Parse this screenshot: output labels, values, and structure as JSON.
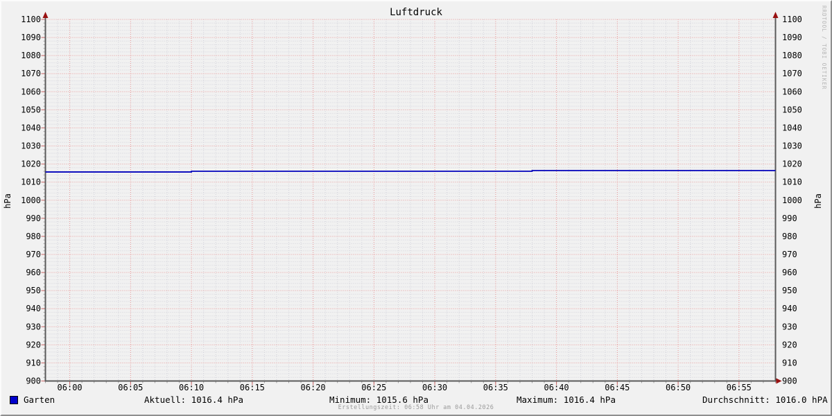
{
  "title": "Luftdruck",
  "watermark": "RRDTOOL / TOBI OETIKER",
  "axes": {
    "unit_left": "hPa",
    "unit_right": "hPa"
  },
  "legend": {
    "series_label": "Garten",
    "series_color": "#0000cc",
    "current": "Aktuell: 1016.4 hPa",
    "minimum": "Minimum: 1015.6 hPa",
    "maximum": "Maximum: 1016.4 hPa",
    "average": "Durchschnitt: 1016.0 hPA"
  },
  "footer": {
    "creation_note": "Erstellungszeit: 06:58 Uhr am 04.04.2026"
  },
  "chart_data": {
    "type": "line",
    "title": "Luftdruck",
    "xlabel": "",
    "ylabel": "hPa",
    "ylim": [
      900,
      1100
    ],
    "y_major_step": 10,
    "y_minor_step": 2,
    "x_start": "05:58",
    "x_end": "06:58",
    "x_minor_step_minutes": 1,
    "x_ticks": [
      "06:00",
      "06:05",
      "06:10",
      "06:15",
      "06:20",
      "06:25",
      "06:30",
      "06:35",
      "06:40",
      "06:45",
      "06:50",
      "06:55"
    ],
    "grid_on": true,
    "grid": {
      "major_color": "#e89595",
      "minor_color": "#d2d2da"
    },
    "legend_position": "bottom",
    "series": [
      {
        "name": "Garten",
        "color": "#0000bb",
        "segments": [
          {
            "from": "05:58",
            "to": "06:10",
            "value": 1015.6
          },
          {
            "from": "06:10",
            "to": "06:38",
            "value": 1016.0
          },
          {
            "from": "06:38",
            "to": "06:58",
            "value": 1016.4
          }
        ]
      }
    ],
    "stats": {
      "current": 1016.4,
      "minimum": 1015.6,
      "maximum": 1016.4,
      "average": 1016.0
    }
  }
}
